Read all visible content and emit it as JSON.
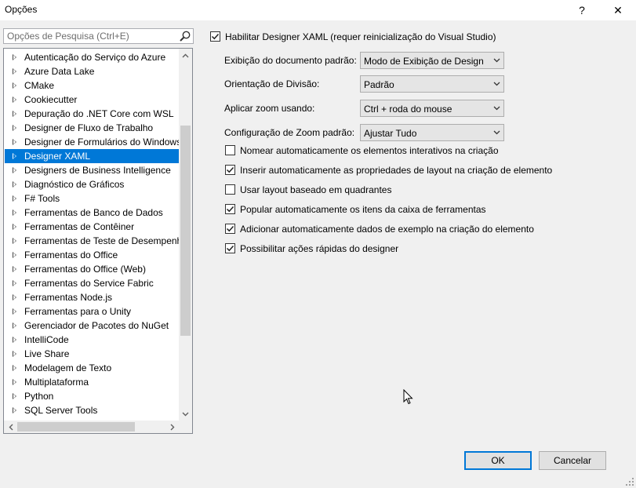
{
  "window": {
    "title": "Opções",
    "help_label": "?",
    "close_label": "✕"
  },
  "search": {
    "placeholder": "Opções de Pesquisa (Ctrl+E)"
  },
  "tree": {
    "items": [
      {
        "label": "Autenticação do Serviço do Azure"
      },
      {
        "label": "Azure Data Lake"
      },
      {
        "label": "CMake"
      },
      {
        "label": "Cookiecutter"
      },
      {
        "label": "Depuração do .NET Core com WSL"
      },
      {
        "label": "Designer de Fluxo de Trabalho"
      },
      {
        "label": "Designer de Formulários do Windows"
      },
      {
        "label": "Designer XAML",
        "selected": true
      },
      {
        "label": "Designers de Business Intelligence"
      },
      {
        "label": "Diagnóstico de Gráficos"
      },
      {
        "label": "F# Tools"
      },
      {
        "label": "Ferramentas de Banco de Dados"
      },
      {
        "label": "Ferramentas de Contêiner"
      },
      {
        "label": "Ferramentas de Teste de Desempenho"
      },
      {
        "label": "Ferramentas do Office"
      },
      {
        "label": "Ferramentas do Office (Web)"
      },
      {
        "label": "Ferramentas do Service Fabric"
      },
      {
        "label": "Ferramentas Node.js"
      },
      {
        "label": "Ferramentas para o Unity"
      },
      {
        "label": "Gerenciador de Pacotes do NuGet"
      },
      {
        "label": "IntelliCode"
      },
      {
        "label": "Live Share"
      },
      {
        "label": "Modelagem de Texto"
      },
      {
        "label": "Multiplataforma"
      },
      {
        "label": "Python"
      },
      {
        "label": "SQL Server Tools"
      }
    ]
  },
  "main": {
    "enable_designer": {
      "label": "Habilitar Designer XAML (requer reinicialização do Visual Studio)",
      "checked": true
    },
    "fields": [
      {
        "label": "Exibição do documento padrão:",
        "value": "Modo de Exibição de Design"
      },
      {
        "label": "Orientação de Divisão:",
        "value": "Padrão"
      },
      {
        "label": "Aplicar zoom usando:",
        "value": "Ctrl + roda do mouse"
      },
      {
        "label": "Configuração de Zoom padrão:",
        "value": "Ajustar Tudo"
      }
    ],
    "options": [
      {
        "label": "Nomear automaticamente os elementos interativos na criação",
        "checked": false
      },
      {
        "label": "Inserir automaticamente as propriedades de layout na criação de elemento",
        "checked": true
      },
      {
        "label": "Usar layout baseado em quadrantes",
        "checked": false
      },
      {
        "label": "Popular automaticamente os itens da caixa de ferramentas",
        "checked": true
      },
      {
        "label": "Adicionar automaticamente dados de exemplo na criação do elemento",
        "checked": true
      },
      {
        "label": "Possibilitar ações rápidas do designer",
        "checked": true
      }
    ]
  },
  "buttons": {
    "ok": "OK",
    "cancel": "Cancelar"
  }
}
